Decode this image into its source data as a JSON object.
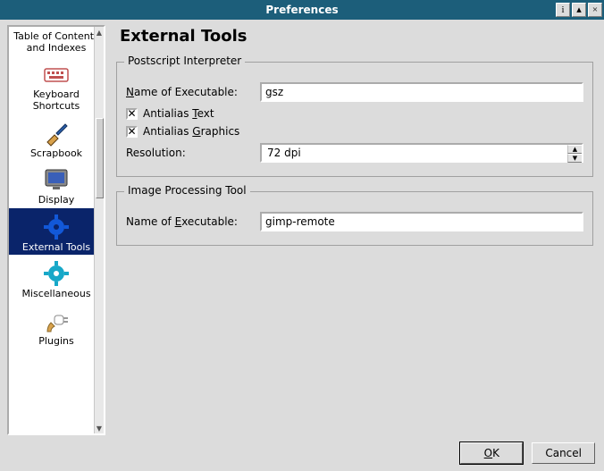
{
  "window": {
    "title": "Preferences"
  },
  "sidebar": {
    "items": [
      {
        "label": "Table of Contents and Indexes",
        "icon": "blank"
      },
      {
        "label": "Keyboard Shortcuts",
        "icon": "keyboard"
      },
      {
        "label": "Scrapbook",
        "icon": "brush"
      },
      {
        "label": "Display",
        "icon": "monitor"
      },
      {
        "label": "External Tools",
        "icon": "gear-blue",
        "selected": true
      },
      {
        "label": "Miscellaneous",
        "icon": "gear-teal"
      },
      {
        "label": "Plugins",
        "icon": "plug"
      }
    ]
  },
  "main": {
    "title": "External Tools",
    "group_ps": {
      "legend": "Postscript Interpreter",
      "name_prefix": "N",
      "name_rest": "ame of Executable:",
      "name_value": "gsz",
      "chk1_prefix": "Antialias ",
      "chk1_u": "T",
      "chk1_suffix": "ext",
      "chk1_checked": true,
      "chk2_prefix": "Antialias ",
      "chk2_u": "G",
      "chk2_suffix": "raphics",
      "chk2_checked": true,
      "res_label": "Resolution:",
      "res_value": "72 dpi"
    },
    "group_img": {
      "legend": "Image Processing Tool",
      "name_prefix": "Name of ",
      "name_u": "E",
      "name_suffix": "xecutable:",
      "name_value": "gimp-remote"
    }
  },
  "buttons": {
    "ok_u": "O",
    "ok_rest": "K",
    "cancel": "Cancel"
  }
}
